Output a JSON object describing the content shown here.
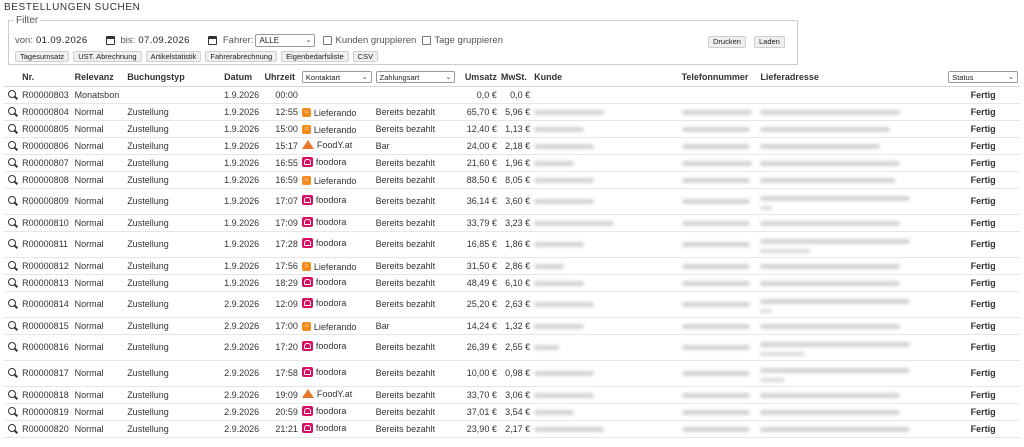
{
  "page": {
    "title": "BESTELLUNGEN SUCHEN"
  },
  "filter": {
    "legend": "Filter",
    "from_label": "von:",
    "from_value": "01.09.2026",
    "to_label": "bis:",
    "to_value": "07.09.2026",
    "driver_label": "Fahrer:",
    "driver_value": "ALLE",
    "group_customers": "Kunden gruppieren",
    "group_days": "Tage gruppieren",
    "buttons": [
      "Tagesumsatz",
      "UST. Abrechnung",
      "Artikelstatistik",
      "Fahrerabrechnung",
      "Eigenbedarfsliste",
      "CSV"
    ],
    "print": "Drucken",
    "load": "Laden"
  },
  "table": {
    "headers": {
      "nr": "Nr.",
      "relevanz": "Relevanz",
      "buchungstyp": "Buchungstyp",
      "datum": "Datum",
      "uhrzeit": "Uhrzeit",
      "kontaktart": "Kontaktart",
      "zahlungsart": "Zahlungsart",
      "umsatz": "Umsatz",
      "mwst": "MwSt.",
      "kunde": "Kunde",
      "telefon": "Telefonnummer",
      "lieferadresse": "Lieferadresse",
      "status": "Status"
    },
    "rows": [
      {
        "nr": "R00000803",
        "relevanz": "Monatsbon",
        "typ": "",
        "datum": "1.9.2026",
        "zeit": "00:00",
        "platform": "",
        "logo": "",
        "zahlung": "",
        "umsatz": "0,0 €",
        "mwst": "0,0 €",
        "status": "Fertig",
        "h": 17,
        "kw": 0,
        "tw": 0,
        "aw": 0,
        "a2": 0
      },
      {
        "nr": "R00000804",
        "relevanz": "Normal",
        "typ": "Zustellung",
        "datum": "1.9.2026",
        "zeit": "12:55",
        "platform": "Lieferando",
        "logo": "lieferando",
        "zahlung": "Bereits bezahlt",
        "umsatz": "65,70 €",
        "mwst": "5,96 €",
        "status": "Fertig",
        "h": 17,
        "kw": 70,
        "tw": 70,
        "aw": 140,
        "a2": 0
      },
      {
        "nr": "R00000805",
        "relevanz": "Normal",
        "typ": "Zustellung",
        "datum": "1.9.2026",
        "zeit": "15:00",
        "platform": "Lieferando",
        "logo": "lieferando",
        "zahlung": "Bereits bezahlt",
        "umsatz": "12,40 €",
        "mwst": "1,13 €",
        "status": "Fertig",
        "h": 17,
        "kw": 50,
        "tw": 68,
        "aw": 130,
        "a2": 0
      },
      {
        "nr": "R00000806",
        "relevanz": "Normal",
        "typ": "Zustellung",
        "datum": "1.9.2026",
        "zeit": "15:17",
        "platform": "FoodY.at",
        "logo": "foody",
        "zahlung": "Bar",
        "umsatz": "24,00 €",
        "mwst": "2,18 €",
        "status": "Fertig",
        "h": 17,
        "kw": 60,
        "tw": 68,
        "aw": 120,
        "a2": 0
      },
      {
        "nr": "R00000807",
        "relevanz": "Normal",
        "typ": "Zustellung",
        "datum": "1.9.2026",
        "zeit": "16:55",
        "platform": "foodora",
        "logo": "foodora",
        "zahlung": "Bereits bezahlt",
        "umsatz": "21,60 €",
        "mwst": "1,96 €",
        "status": "Fertig",
        "h": 17,
        "kw": 40,
        "tw": 70,
        "aw": 140,
        "a2": 0
      },
      {
        "nr": "R00000808",
        "relevanz": "Normal",
        "typ": "Zustellung",
        "datum": "1.9.2026",
        "zeit": "16:59",
        "platform": "Lieferando",
        "logo": "lieferando",
        "zahlung": "Bereits bezahlt",
        "umsatz": "88,50 €",
        "mwst": "8,05 €",
        "status": "Fertig",
        "h": 17,
        "kw": 60,
        "tw": 68,
        "aw": 135,
        "a2": 0
      },
      {
        "nr": "R00000809",
        "relevanz": "Normal",
        "typ": "Zustellung",
        "datum": "1.9.2026",
        "zeit": "17:07",
        "platform": "foodora",
        "logo": "foodora",
        "zahlung": "Bereits bezahlt",
        "umsatz": "36,14 €",
        "mwst": "3,60 €",
        "status": "Fertig",
        "h": 26,
        "kw": 60,
        "tw": 68,
        "aw": 150,
        "a2": 12
      },
      {
        "nr": "R00000810",
        "relevanz": "Normal",
        "typ": "Zustellung",
        "datum": "1.9.2026",
        "zeit": "17:09",
        "platform": "foodora",
        "logo": "foodora",
        "zahlung": "Bereits bezahlt",
        "umsatz": "33,79 €",
        "mwst": "3,23 €",
        "status": "Fertig",
        "h": 17,
        "kw": 80,
        "tw": 68,
        "aw": 140,
        "a2": 0
      },
      {
        "nr": "R00000811",
        "relevanz": "Normal",
        "typ": "Zustellung",
        "datum": "1.9.2026",
        "zeit": "17:28",
        "platform": "foodora",
        "logo": "foodora",
        "zahlung": "Bereits bezahlt",
        "umsatz": "16,85 €",
        "mwst": "1,86 €",
        "status": "Fertig",
        "h": 26,
        "kw": 50,
        "tw": 68,
        "aw": 150,
        "a2": 50
      },
      {
        "nr": "R00000812",
        "relevanz": "Normal",
        "typ": "Zustellung",
        "datum": "1.9.2026",
        "zeit": "17:56",
        "platform": "Lieferando",
        "logo": "lieferando",
        "zahlung": "Bereits bezahlt",
        "umsatz": "31,50 €",
        "mwst": "2,86 €",
        "status": "Fertig",
        "h": 17,
        "kw": 30,
        "tw": 68,
        "aw": 140,
        "a2": 0
      },
      {
        "nr": "R00000813",
        "relevanz": "Normal",
        "typ": "Zustellung",
        "datum": "1.9.2026",
        "zeit": "18:29",
        "platform": "foodora",
        "logo": "foodora",
        "zahlung": "Bereits bezahlt",
        "umsatz": "48,49 €",
        "mwst": "6,10 €",
        "status": "Fertig",
        "h": 17,
        "kw": 50,
        "tw": 68,
        "aw": 140,
        "a2": 0
      },
      {
        "nr": "R00000814",
        "relevanz": "Normal",
        "typ": "Zustellung",
        "datum": "2.9.2026",
        "zeit": "12:09",
        "platform": "foodora",
        "logo": "foodora",
        "zahlung": "Bereits bezahlt",
        "umsatz": "25,20 €",
        "mwst": "2,63 €",
        "status": "Fertig",
        "h": 26,
        "kw": 60,
        "tw": 68,
        "aw": 150,
        "a2": 12
      },
      {
        "nr": "R00000815",
        "relevanz": "Normal",
        "typ": "Zustellung",
        "datum": "2.9.2026",
        "zeit": "17:00",
        "platform": "Lieferando",
        "logo": "lieferando",
        "zahlung": "Bar",
        "umsatz": "14,24 €",
        "mwst": "1,32 €",
        "status": "Fertig",
        "h": 17,
        "kw": 50,
        "tw": 68,
        "aw": 140,
        "a2": 0
      },
      {
        "nr": "R00000816",
        "relevanz": "Normal",
        "typ": "Zustellung",
        "datum": "2.9.2026",
        "zeit": "17:20",
        "platform": "foodora",
        "logo": "foodora",
        "zahlung": "Bereits bezahlt",
        "umsatz": "26,39 €",
        "mwst": "2,55 €",
        "status": "Fertig",
        "h": 26,
        "kw": 25,
        "tw": 68,
        "aw": 150,
        "a2": 45
      },
      {
        "nr": "R00000817",
        "relevanz": "Normal",
        "typ": "Zustellung",
        "datum": "2.9.2026",
        "zeit": "17:58",
        "platform": "foodora",
        "logo": "foodora",
        "zahlung": "Bereits bezahlt",
        "umsatz": "10,00 €",
        "mwst": "0,98 €",
        "status": "Fertig",
        "h": 26,
        "kw": 60,
        "tw": 68,
        "aw": 150,
        "a2": 25
      },
      {
        "nr": "R00000818",
        "relevanz": "Normal",
        "typ": "Zustellung",
        "datum": "2.9.2026",
        "zeit": "19:09",
        "platform": "FoodY.at",
        "logo": "foody",
        "zahlung": "Bereits bezahlt",
        "umsatz": "33,70 €",
        "mwst": "3,06 €",
        "status": "Fertig",
        "h": 17,
        "kw": 60,
        "tw": 68,
        "aw": 140,
        "a2": 0
      },
      {
        "nr": "R00000819",
        "relevanz": "Normal",
        "typ": "Zustellung",
        "datum": "2.9.2026",
        "zeit": "20:59",
        "platform": "foodora",
        "logo": "foodora",
        "zahlung": "Bereits bezahlt",
        "umsatz": "37,01 €",
        "mwst": "3,54 €",
        "status": "Fertig",
        "h": 17,
        "kw": 40,
        "tw": 68,
        "aw": 140,
        "a2": 0
      },
      {
        "nr": "R00000820",
        "relevanz": "Normal",
        "typ": "Zustellung",
        "datum": "2.9.2026",
        "zeit": "21:21",
        "platform": "foodora",
        "logo": "foodora",
        "zahlung": "Bereits bezahlt",
        "umsatz": "23,90 €",
        "mwst": "2,17 €",
        "status": "Fertig",
        "h": 17,
        "kw": 70,
        "tw": 68,
        "aw": 150,
        "a2": 0
      }
    ]
  }
}
